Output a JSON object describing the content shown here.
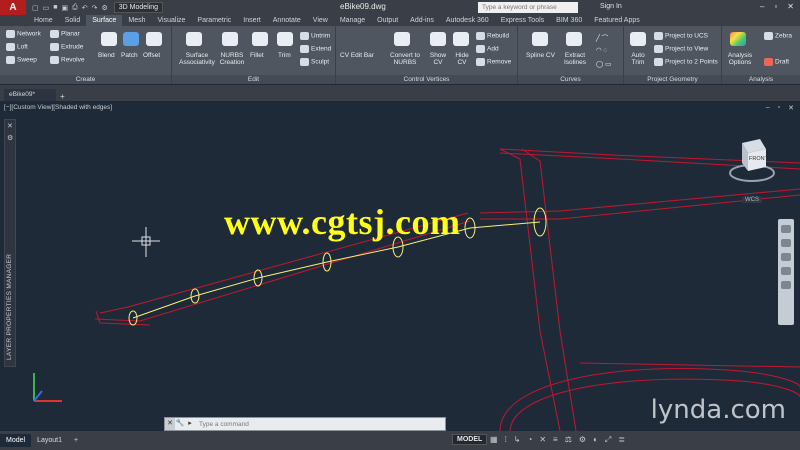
{
  "titlebar": {
    "app_logo": "A",
    "workspace": "3D Modeling",
    "doc_title": "eBike09.dwg",
    "search_placeholder": "Type a keyword or phrase",
    "signin": "Sign In"
  },
  "tabs": [
    "Home",
    "Solid",
    "Surface",
    "Mesh",
    "Visualize",
    "Parametric",
    "Insert",
    "Annotate",
    "View",
    "Manage",
    "Output",
    "Add-ins",
    "Autodesk 360",
    "Express Tools",
    "BIM 360",
    "Featured Apps"
  ],
  "active_tab": "Surface",
  "ribbon": {
    "create": {
      "title": "Create",
      "small": [
        "Network",
        "Loft",
        "Sweep",
        "Planar",
        "Extrude",
        "Revolve"
      ],
      "large": [
        "Blend",
        "Patch",
        "Offset"
      ]
    },
    "edit": {
      "title": "Edit",
      "large": [
        "Surface Associativity",
        "NURBS Creation",
        "Fillet",
        "Trim"
      ],
      "small": [
        "Untrim",
        "Extend",
        "Sculpt"
      ]
    },
    "control_vertices": {
      "title": "Control Vertices",
      "large": [
        "CV Edit Bar",
        "Convert to NURBS",
        "Show CV",
        "Hide CV"
      ],
      "small": [
        "Rebuild",
        "Add",
        "Remove"
      ]
    },
    "curves": {
      "title": "Curves",
      "large": [
        "Spline CV",
        "Extract Isolines"
      ]
    },
    "project_geometry": {
      "title": "Project Geometry",
      "large": [
        "Auto Trim"
      ],
      "small": [
        "Project to UCS",
        "Project to View",
        "Project to 2 Points"
      ]
    },
    "analysis": {
      "title": "Analysis",
      "large": [
        "Analysis Options"
      ],
      "small": [
        "Zebra",
        "Draft"
      ]
    }
  },
  "file_tab": "eBike09*",
  "viewport": {
    "label": "[−][Custom View][Shaded with edges]",
    "layer_palette": "LAYER PROPERTIES MANAGER",
    "viewcube_face": "FRONT",
    "viewcube_label": "WCS",
    "watermark": "www.cgtsj.com",
    "brand": "lynda.com"
  },
  "commandline": {
    "placeholder": "Type a command"
  },
  "statusbar": {
    "layouts": [
      "Model",
      "Layout1"
    ],
    "model": "MODEL"
  },
  "colors": {
    "accent_red": "#b21e1e",
    "frame_red": "#c01830",
    "path_yellow": "#f5f07a",
    "watermark": "#ffff1a",
    "viewport_bg": "#1f2a38"
  }
}
